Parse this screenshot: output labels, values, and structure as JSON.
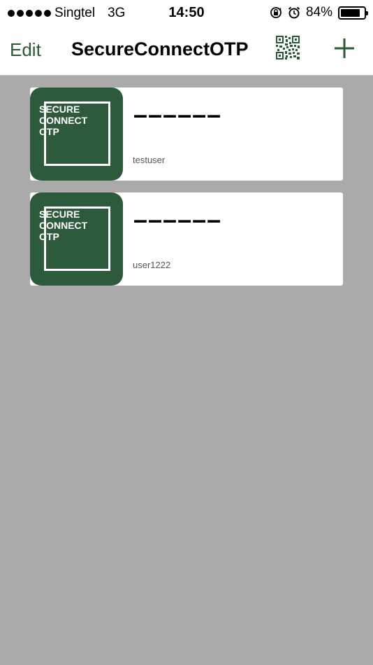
{
  "status_bar": {
    "carrier": "Singtel",
    "network": "3G",
    "time": "14:50",
    "battery_percent_label": "84%",
    "battery_level": 0.84,
    "icons": [
      "signal-dots",
      "rotation-lock-icon",
      "alarm-icon",
      "battery-icon"
    ]
  },
  "nav": {
    "edit_label": "Edit",
    "title": "SecureConnectOTP",
    "qr_icon": "qr-code-icon",
    "add_icon": "plus-icon"
  },
  "accent_color": "#2a5a35",
  "logo_color": "#2e5a3c",
  "tokens": [
    {
      "logo_lines": [
        "SECURE",
        "CONNECT",
        "OTP"
      ],
      "code": "––––––",
      "username": "testuser"
    },
    {
      "logo_lines": [
        "SECURE",
        "CONNECT",
        "OTP"
      ],
      "code": "––––––",
      "username": "user1222"
    }
  ]
}
